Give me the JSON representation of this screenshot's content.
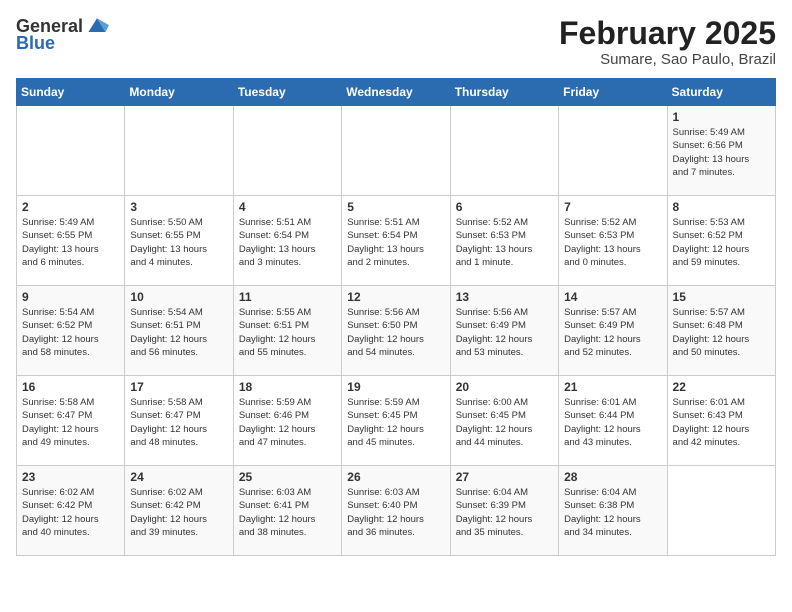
{
  "header": {
    "logo_general": "General",
    "logo_blue": "Blue",
    "title": "February 2025",
    "subtitle": "Sumare, Sao Paulo, Brazil"
  },
  "days_of_week": [
    "Sunday",
    "Monday",
    "Tuesday",
    "Wednesday",
    "Thursday",
    "Friday",
    "Saturday"
  ],
  "weeks": [
    [
      {
        "day": "",
        "info": ""
      },
      {
        "day": "",
        "info": ""
      },
      {
        "day": "",
        "info": ""
      },
      {
        "day": "",
        "info": ""
      },
      {
        "day": "",
        "info": ""
      },
      {
        "day": "",
        "info": ""
      },
      {
        "day": "1",
        "info": "Sunrise: 5:49 AM\nSunset: 6:56 PM\nDaylight: 13 hours\nand 7 minutes."
      }
    ],
    [
      {
        "day": "2",
        "info": "Sunrise: 5:49 AM\nSunset: 6:55 PM\nDaylight: 13 hours\nand 6 minutes."
      },
      {
        "day": "3",
        "info": "Sunrise: 5:50 AM\nSunset: 6:55 PM\nDaylight: 13 hours\nand 4 minutes."
      },
      {
        "day": "4",
        "info": "Sunrise: 5:51 AM\nSunset: 6:54 PM\nDaylight: 13 hours\nand 3 minutes."
      },
      {
        "day": "5",
        "info": "Sunrise: 5:51 AM\nSunset: 6:54 PM\nDaylight: 13 hours\nand 2 minutes."
      },
      {
        "day": "6",
        "info": "Sunrise: 5:52 AM\nSunset: 6:53 PM\nDaylight: 13 hours\nand 1 minute."
      },
      {
        "day": "7",
        "info": "Sunrise: 5:52 AM\nSunset: 6:53 PM\nDaylight: 13 hours\nand 0 minutes."
      },
      {
        "day": "8",
        "info": "Sunrise: 5:53 AM\nSunset: 6:52 PM\nDaylight: 12 hours\nand 59 minutes."
      }
    ],
    [
      {
        "day": "9",
        "info": "Sunrise: 5:54 AM\nSunset: 6:52 PM\nDaylight: 12 hours\nand 58 minutes."
      },
      {
        "day": "10",
        "info": "Sunrise: 5:54 AM\nSunset: 6:51 PM\nDaylight: 12 hours\nand 56 minutes."
      },
      {
        "day": "11",
        "info": "Sunrise: 5:55 AM\nSunset: 6:51 PM\nDaylight: 12 hours\nand 55 minutes."
      },
      {
        "day": "12",
        "info": "Sunrise: 5:56 AM\nSunset: 6:50 PM\nDaylight: 12 hours\nand 54 minutes."
      },
      {
        "day": "13",
        "info": "Sunrise: 5:56 AM\nSunset: 6:49 PM\nDaylight: 12 hours\nand 53 minutes."
      },
      {
        "day": "14",
        "info": "Sunrise: 5:57 AM\nSunset: 6:49 PM\nDaylight: 12 hours\nand 52 minutes."
      },
      {
        "day": "15",
        "info": "Sunrise: 5:57 AM\nSunset: 6:48 PM\nDaylight: 12 hours\nand 50 minutes."
      }
    ],
    [
      {
        "day": "16",
        "info": "Sunrise: 5:58 AM\nSunset: 6:47 PM\nDaylight: 12 hours\nand 49 minutes."
      },
      {
        "day": "17",
        "info": "Sunrise: 5:58 AM\nSunset: 6:47 PM\nDaylight: 12 hours\nand 48 minutes."
      },
      {
        "day": "18",
        "info": "Sunrise: 5:59 AM\nSunset: 6:46 PM\nDaylight: 12 hours\nand 47 minutes."
      },
      {
        "day": "19",
        "info": "Sunrise: 5:59 AM\nSunset: 6:45 PM\nDaylight: 12 hours\nand 45 minutes."
      },
      {
        "day": "20",
        "info": "Sunrise: 6:00 AM\nSunset: 6:45 PM\nDaylight: 12 hours\nand 44 minutes."
      },
      {
        "day": "21",
        "info": "Sunrise: 6:01 AM\nSunset: 6:44 PM\nDaylight: 12 hours\nand 43 minutes."
      },
      {
        "day": "22",
        "info": "Sunrise: 6:01 AM\nSunset: 6:43 PM\nDaylight: 12 hours\nand 42 minutes."
      }
    ],
    [
      {
        "day": "23",
        "info": "Sunrise: 6:02 AM\nSunset: 6:42 PM\nDaylight: 12 hours\nand 40 minutes."
      },
      {
        "day": "24",
        "info": "Sunrise: 6:02 AM\nSunset: 6:42 PM\nDaylight: 12 hours\nand 39 minutes."
      },
      {
        "day": "25",
        "info": "Sunrise: 6:03 AM\nSunset: 6:41 PM\nDaylight: 12 hours\nand 38 minutes."
      },
      {
        "day": "26",
        "info": "Sunrise: 6:03 AM\nSunset: 6:40 PM\nDaylight: 12 hours\nand 36 minutes."
      },
      {
        "day": "27",
        "info": "Sunrise: 6:04 AM\nSunset: 6:39 PM\nDaylight: 12 hours\nand 35 minutes."
      },
      {
        "day": "28",
        "info": "Sunrise: 6:04 AM\nSunset: 6:38 PM\nDaylight: 12 hours\nand 34 minutes."
      },
      {
        "day": "",
        "info": ""
      }
    ]
  ]
}
